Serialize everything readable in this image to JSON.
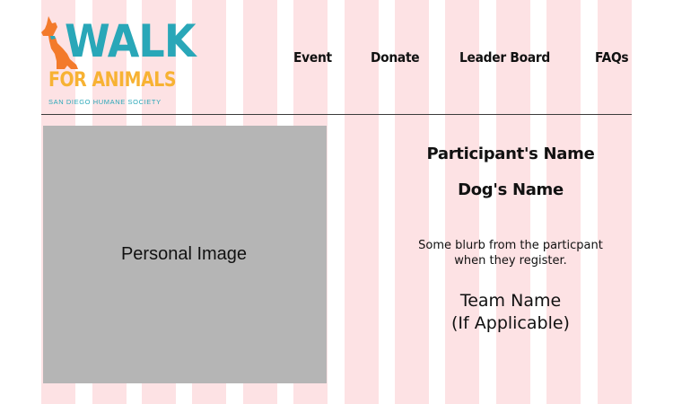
{
  "colors": {
    "stripe": "#fde2e4",
    "logo_teal": "#29a7b8",
    "logo_orange": "#f37a2b",
    "logo_gold": "#f7b233",
    "photo_placeholder": "#b5b5b5"
  },
  "logo": {
    "word": "WALK",
    "tagline": "FOR ANIMALS",
    "organization": "SAN DIEGO HUMANE SOCIETY",
    "icon": "dog-silhouette-icon"
  },
  "nav": {
    "items": [
      {
        "label": "Event"
      },
      {
        "label": "Donate"
      },
      {
        "label": "Leader Board"
      },
      {
        "label": "FAQs"
      }
    ]
  },
  "profile": {
    "image_label": "Personal Image",
    "participant_name": "Participant's Name",
    "dog_name": "Dog's Name",
    "blurb_line1": "Some blurb from the particpant",
    "blurb_line2": "when they register.",
    "team_line1": "Team Name",
    "team_line2": "(If Applicable)"
  }
}
